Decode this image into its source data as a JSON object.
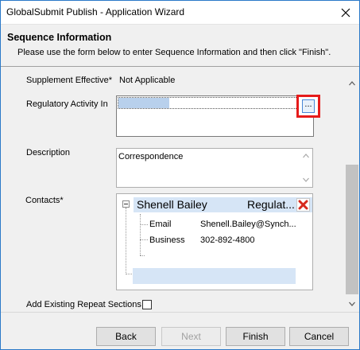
{
  "window": {
    "title": "GlobalSubmit Publish - Application Wizard"
  },
  "header": {
    "title": "Sequence Information",
    "description": "Please use the form below to enter Sequence Information and then click \"Finish\"."
  },
  "form": {
    "supplement_effective_label": "Supplement Effective*",
    "supplement_effective_value": "Not Applicable",
    "regulatory_activity_label": "Regulatory Activity In",
    "regulatory_activity_button": "...",
    "description_label": "Description",
    "description_value": "Correspondence",
    "contacts_label": "Contacts*",
    "contact": {
      "name": "Shenell Bailey",
      "role": "Regulat...",
      "fields": [
        {
          "label": "Email",
          "value": "Shenell.Bailey@Synch..."
        },
        {
          "label": "Business",
          "value": "302-892-4800"
        }
      ]
    },
    "repeat_sections_label": "Add Existing Repeat Sections",
    "repeat_sections_checked": false
  },
  "buttons": {
    "back": "Back",
    "next": "Next",
    "finish": "Finish",
    "cancel": "Cancel"
  },
  "icons": {
    "close": "close-icon",
    "delete": "red-x-delete-icon",
    "collapse": "collapse-minus-icon",
    "scroll_up": "chevron-up-icon",
    "scroll_down": "chevron-down-icon"
  },
  "colors": {
    "highlight_border": "#e61b1b",
    "selection_fill": "#b8d0ec",
    "contact_header_bg": "#d6e5f6"
  }
}
